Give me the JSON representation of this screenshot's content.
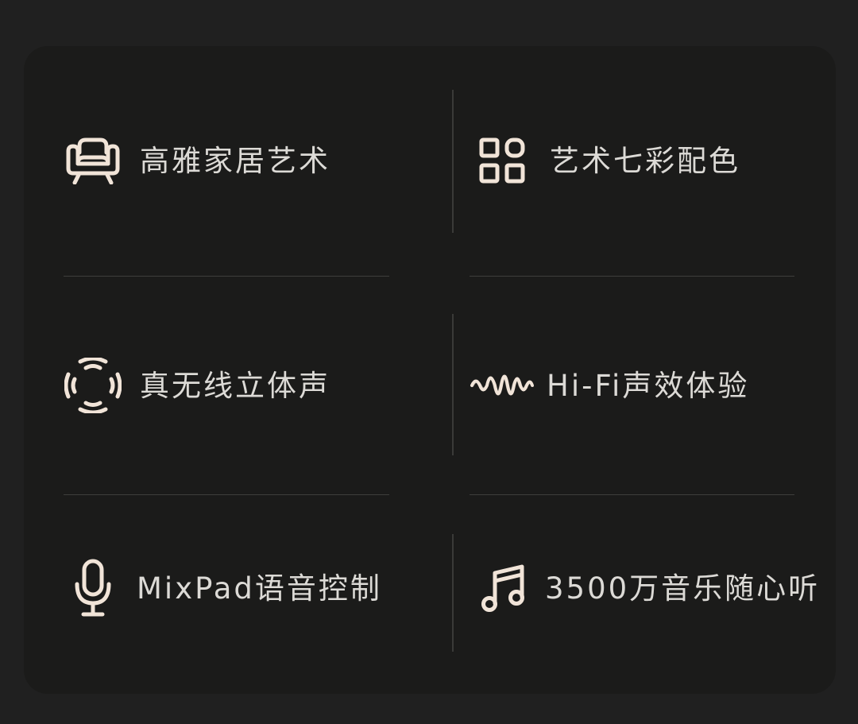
{
  "theme": {
    "page_background": "#202020",
    "card_background": "#1b1b1a",
    "icon_color": "#f1e4d8",
    "text_color": "#dcdad6",
    "divider_color": "#3e3e3c"
  },
  "features": [
    {
      "label": "高雅家居艺术",
      "icon": "sofa-icon"
    },
    {
      "label": "艺术七彩配色",
      "icon": "grid-squares-icon"
    },
    {
      "label": "真无线立体声",
      "icon": "surround-sound-icon"
    },
    {
      "label": "Hi-Fi声效体验",
      "icon": "sound-wave-icon"
    },
    {
      "label": "MixPad语音控制",
      "icon": "microphone-icon"
    },
    {
      "label": "3500万音乐随心听",
      "icon": "music-note-icon"
    }
  ]
}
